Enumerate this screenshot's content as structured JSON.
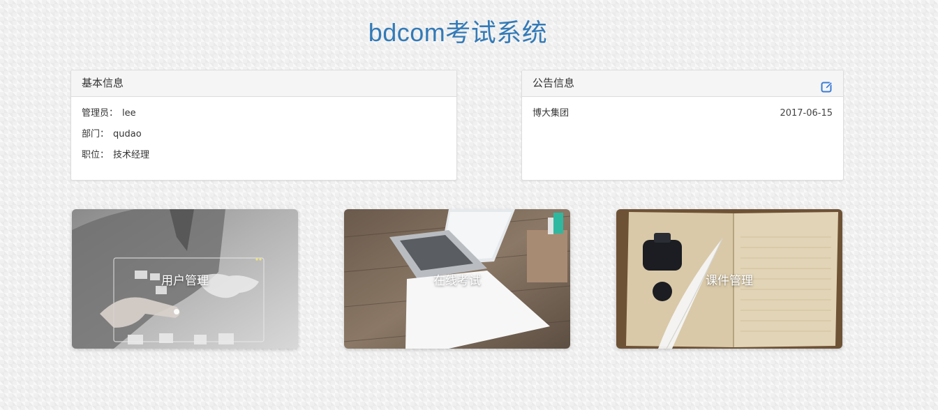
{
  "header": {
    "title": "bdcom考试系统"
  },
  "basic_info": {
    "heading": "基本信息",
    "rows": [
      {
        "label": "管理员：",
        "value": "lee"
      },
      {
        "label": "部门：",
        "value": "qudao"
      },
      {
        "label": "职位：",
        "value": "技术经理"
      }
    ]
  },
  "notice": {
    "heading": "公告信息",
    "edit_icon": "edit-icon",
    "items": [
      {
        "title": "博大集团",
        "date": "2017-06-15"
      }
    ]
  },
  "tiles": [
    {
      "label": "用户管理"
    },
    {
      "label": "在线考试"
    },
    {
      "label": "课件管理"
    }
  ],
  "colors": {
    "accent": "#337ab7",
    "icon": "#3a7bd5"
  }
}
